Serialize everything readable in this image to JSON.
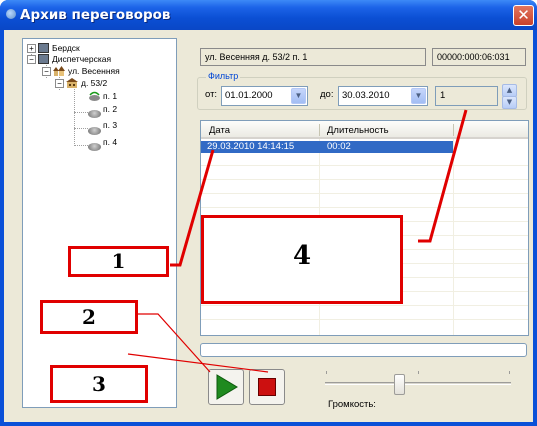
{
  "window": {
    "title": "Архив переговоров",
    "close_label": "✕"
  },
  "tree": {
    "nodes": [
      {
        "label": "Бердск",
        "expander": "+"
      },
      {
        "label": "Диспетчерская",
        "expander": "−"
      },
      {
        "label": "ул. Весенняя",
        "expander": "−"
      },
      {
        "label": "д. 53/2",
        "expander": "−"
      },
      {
        "label": "п. 1"
      },
      {
        "label": "п. 2"
      },
      {
        "label": "п. 3"
      },
      {
        "label": "п. 4"
      }
    ]
  },
  "info": {
    "address": "ул. Весенняя д. 53/2 п. 1",
    "time_counter": "00000:000:06:031"
  },
  "filter": {
    "legend": "Фильтр",
    "from_label": "от:",
    "from_value": "01.01.2000",
    "to_label": "до:",
    "to_value": "30.03.2010",
    "count_value": "1"
  },
  "table": {
    "columns": [
      "Дата",
      "Длительность"
    ],
    "rows": [
      {
        "date": "29.03.2010 14:14:15",
        "duration": "00:02"
      }
    ]
  },
  "player": {
    "volume_label": "Громкость:",
    "volume_level": 0.4
  },
  "callouts": [
    "1",
    "2",
    "3",
    "4"
  ],
  "colors": {
    "callout_red": "#e00000",
    "selection_blue": "#316ac5",
    "play_green": "#1f8a1f",
    "stop_red": "#cc1010"
  }
}
